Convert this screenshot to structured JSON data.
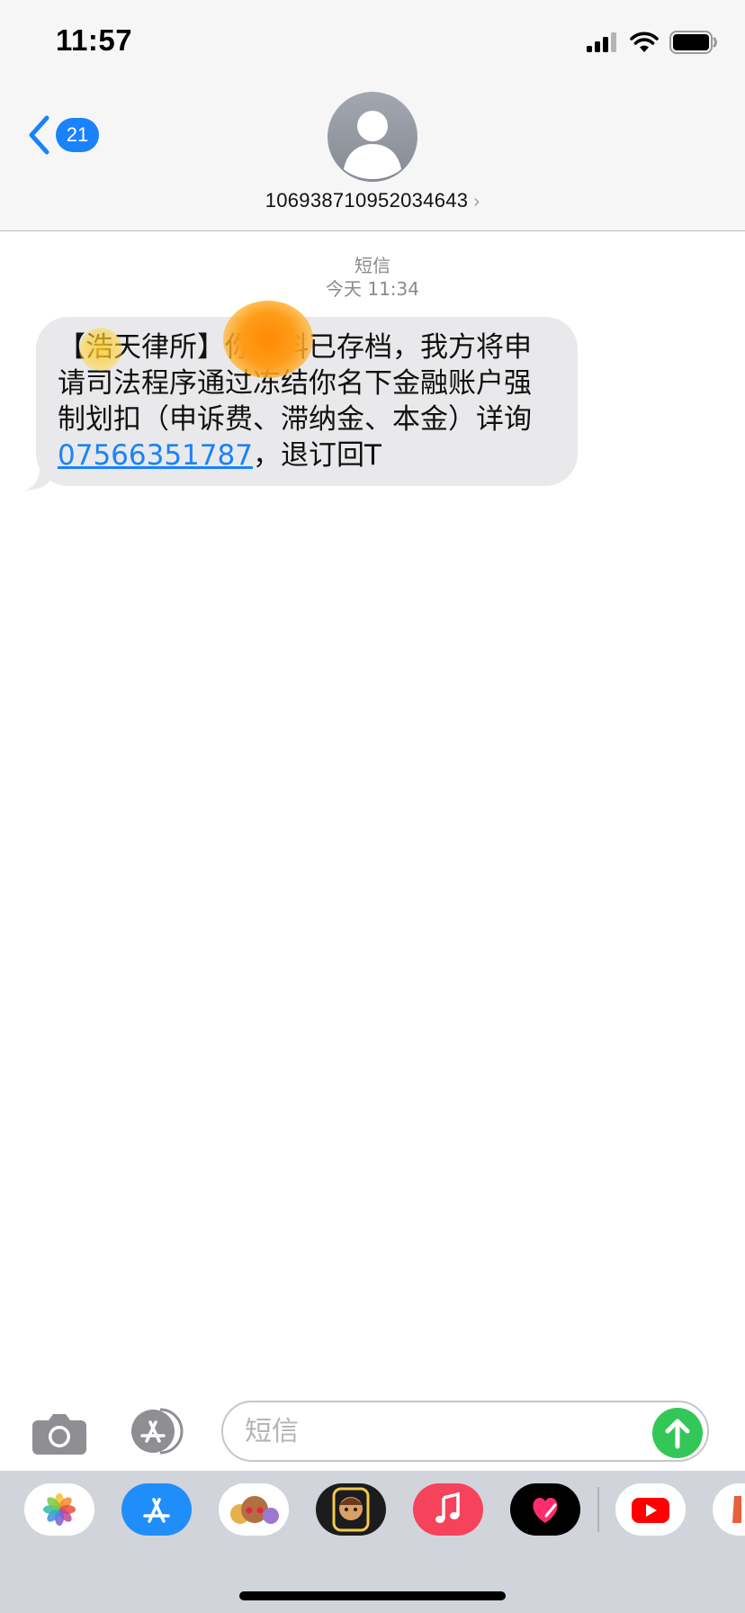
{
  "status_bar": {
    "time": "11:57"
  },
  "header": {
    "back_count": "21",
    "contact_number": "106938710952034643",
    "chevron": "›"
  },
  "conversation": {
    "service_label": "短信",
    "timestamp": "今天 11:34",
    "message": {
      "part1": "【浩天律所】",
      "part2": "你材料已存档，我方将申请司法程序通过冻结你名下金融账户强制划扣（申诉费、滞纳金、本金）详询 ",
      "link": "07566351787",
      "part3": "，退订回T"
    }
  },
  "input_bar": {
    "placeholder": "短信"
  },
  "app_drawer": {
    "apps": [
      "photos-icon",
      "app-store-icon",
      "memoji-stickers-icon",
      "animoji-icon",
      "music-icon",
      "digital-touch-icon",
      "youtube-icon",
      "partial-app-icon"
    ]
  },
  "colors": {
    "accent": "#1a82fb",
    "bubble": "#e9e9eb",
    "send": "#33c758",
    "drawer": "#d2d4db",
    "header": "#f6f6f6"
  }
}
